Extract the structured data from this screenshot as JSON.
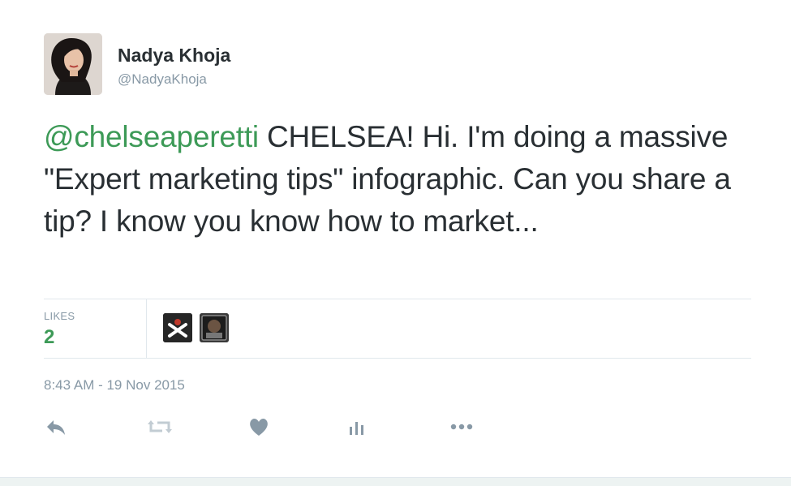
{
  "tweet": {
    "author_name": "Nadya Khoja",
    "author_handle": "@NadyaKhoja",
    "mention": "@chelseaperetti",
    "body": " CHELSEA! Hi. I'm doing a massive \"Expert marketing tips\" infographic. Can you share a tip? I know you know how to market...",
    "likes_label": "LIKES",
    "likes_count": "2",
    "timestamp": "8:43 AM - 19 Nov 2015",
    "accent_color": "#3d9a57",
    "muted_color": "#8899a6"
  },
  "actions": [
    {
      "icon": "reply-icon"
    },
    {
      "icon": "retweet-icon"
    },
    {
      "icon": "heart-icon"
    },
    {
      "icon": "analytics-icon"
    },
    {
      "icon": "more-icon"
    }
  ]
}
